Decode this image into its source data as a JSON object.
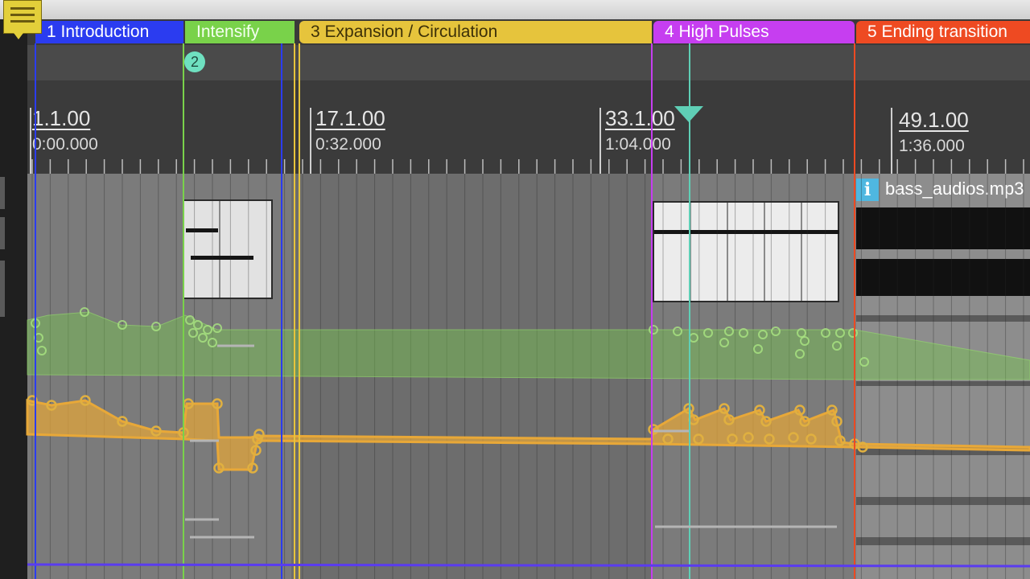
{
  "locators": [
    {
      "label": "1  Introduction"
    },
    {
      "label": "Intensify"
    },
    {
      "label": "3  Expansion / Circulation"
    },
    {
      "label": "4  High Pulses"
    },
    {
      "label": "5  Ending transition"
    }
  ],
  "locator_badge": "2",
  "ruler": {
    "bars": [
      "1.1.00",
      "17.1.00",
      "33.1.00",
      "49.1.00"
    ],
    "times": [
      "0:00.000",
      "0:32.000",
      "1:04.000",
      "1:36.000"
    ]
  },
  "audio_clip": {
    "info_glyph": "i",
    "name": "bass_audios.mp3"
  },
  "colors": {
    "intro": "#2b3cf0",
    "intensify": "#79d24a",
    "expansion": "#e6c43c",
    "high_pulses": "#c63ef0",
    "ending": "#ee4a22",
    "automation_green": "#8acb5a",
    "automation_orange": "#e8a838",
    "playhead": "#5fcfb6"
  },
  "icons": {
    "note": "note-icon",
    "info": "info-icon",
    "playhead": "playhead-marker-icon"
  }
}
